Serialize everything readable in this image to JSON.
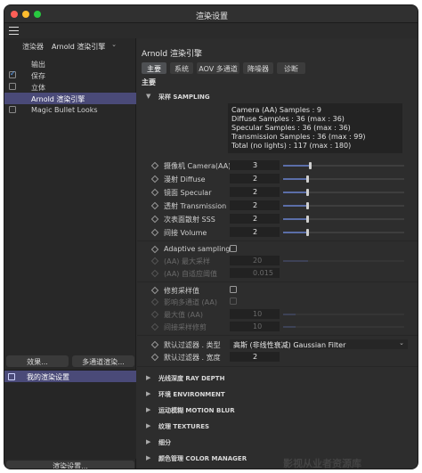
{
  "window": {
    "title": "渲染设置"
  },
  "left": {
    "renderer_label": "渲染器",
    "renderer_value": "Arnold 渲染引擎",
    "tree": [
      {
        "label": "输出",
        "checked": false,
        "has_cb": false,
        "selected": false
      },
      {
        "label": "保存",
        "checked": true,
        "has_cb": true,
        "selected": false
      },
      {
        "label": "立体",
        "checked": false,
        "has_cb": true,
        "selected": false
      },
      {
        "label": "Arnold 渲染引擎",
        "checked": false,
        "has_cb": false,
        "selected": true
      },
      {
        "label": "Magic Bullet Looks",
        "checked": false,
        "has_cb": true,
        "selected": false
      }
    ],
    "effects_button": "效果...",
    "multipass_button": "多通道渲染...",
    "preset_item": "我的渲染设置",
    "render_settings_button": "渲染设置..."
  },
  "right": {
    "title": "Arnold 渲染引擎",
    "tabs": [
      "主要",
      "系统",
      "AOV 多通道",
      "降噪器",
      "诊断"
    ],
    "section": "主要",
    "sampling_header": "采样 SAMPLING",
    "info": [
      "Camera (AA) Samples : 9",
      "Diffuse Samples : 36 (max : 36)",
      "Specular Samples : 36 (max : 36)",
      "Transmission Samples : 36 (max : 99)",
      "Total (no lights) : 117 (max : 180)"
    ],
    "params": [
      {
        "label": "摄像机 Camera(AA)",
        "value": "3",
        "fraction": 0.22
      },
      {
        "label": "漫射 Diffuse",
        "value": "2",
        "fraction": 0.2
      },
      {
        "label": "镜面 Specular",
        "value": "2",
        "fraction": 0.2
      },
      {
        "label": "透射 Transmission",
        "value": "2",
        "fraction": 0.2
      },
      {
        "label": "次表面散射 SSS",
        "value": "2",
        "fraction": 0.2
      },
      {
        "label": "间接 Volume",
        "value": "2",
        "fraction": 0.2
      }
    ],
    "adaptive_label": "Adaptive sampling",
    "aa_max_label": "(AA) 最大采样",
    "aa_max_value": "20",
    "aa_adapt_label": "(AA) 自适应阈值",
    "aa_adapt_value": "0.015",
    "clamp_label": "修剪采样值",
    "clamp_aov_label": "影响多通道 (AA)",
    "max_aa_label": "最大值 (AA)",
    "max_aa_value": "10",
    "indirect_clamp_label": "间接采样修剪",
    "indirect_clamp_value": "10",
    "filter_type_label": "默认过滤器 . 类型",
    "filter_type_value": "高斯 (非线性衰减) Gaussian Filter",
    "filter_width_label": "默认过滤器 . 宽度",
    "filter_width_value": "2",
    "collapsed_groups": [
      "光线深度 RAY DEPTH",
      "环境 ENVIRONMENT",
      "运动模糊 MOTION BLUR",
      "纹理 TEXTURES",
      "细分",
      "颜色管理 COLOR MANAGER"
    ]
  },
  "watermark": "影视从业者资源库"
}
